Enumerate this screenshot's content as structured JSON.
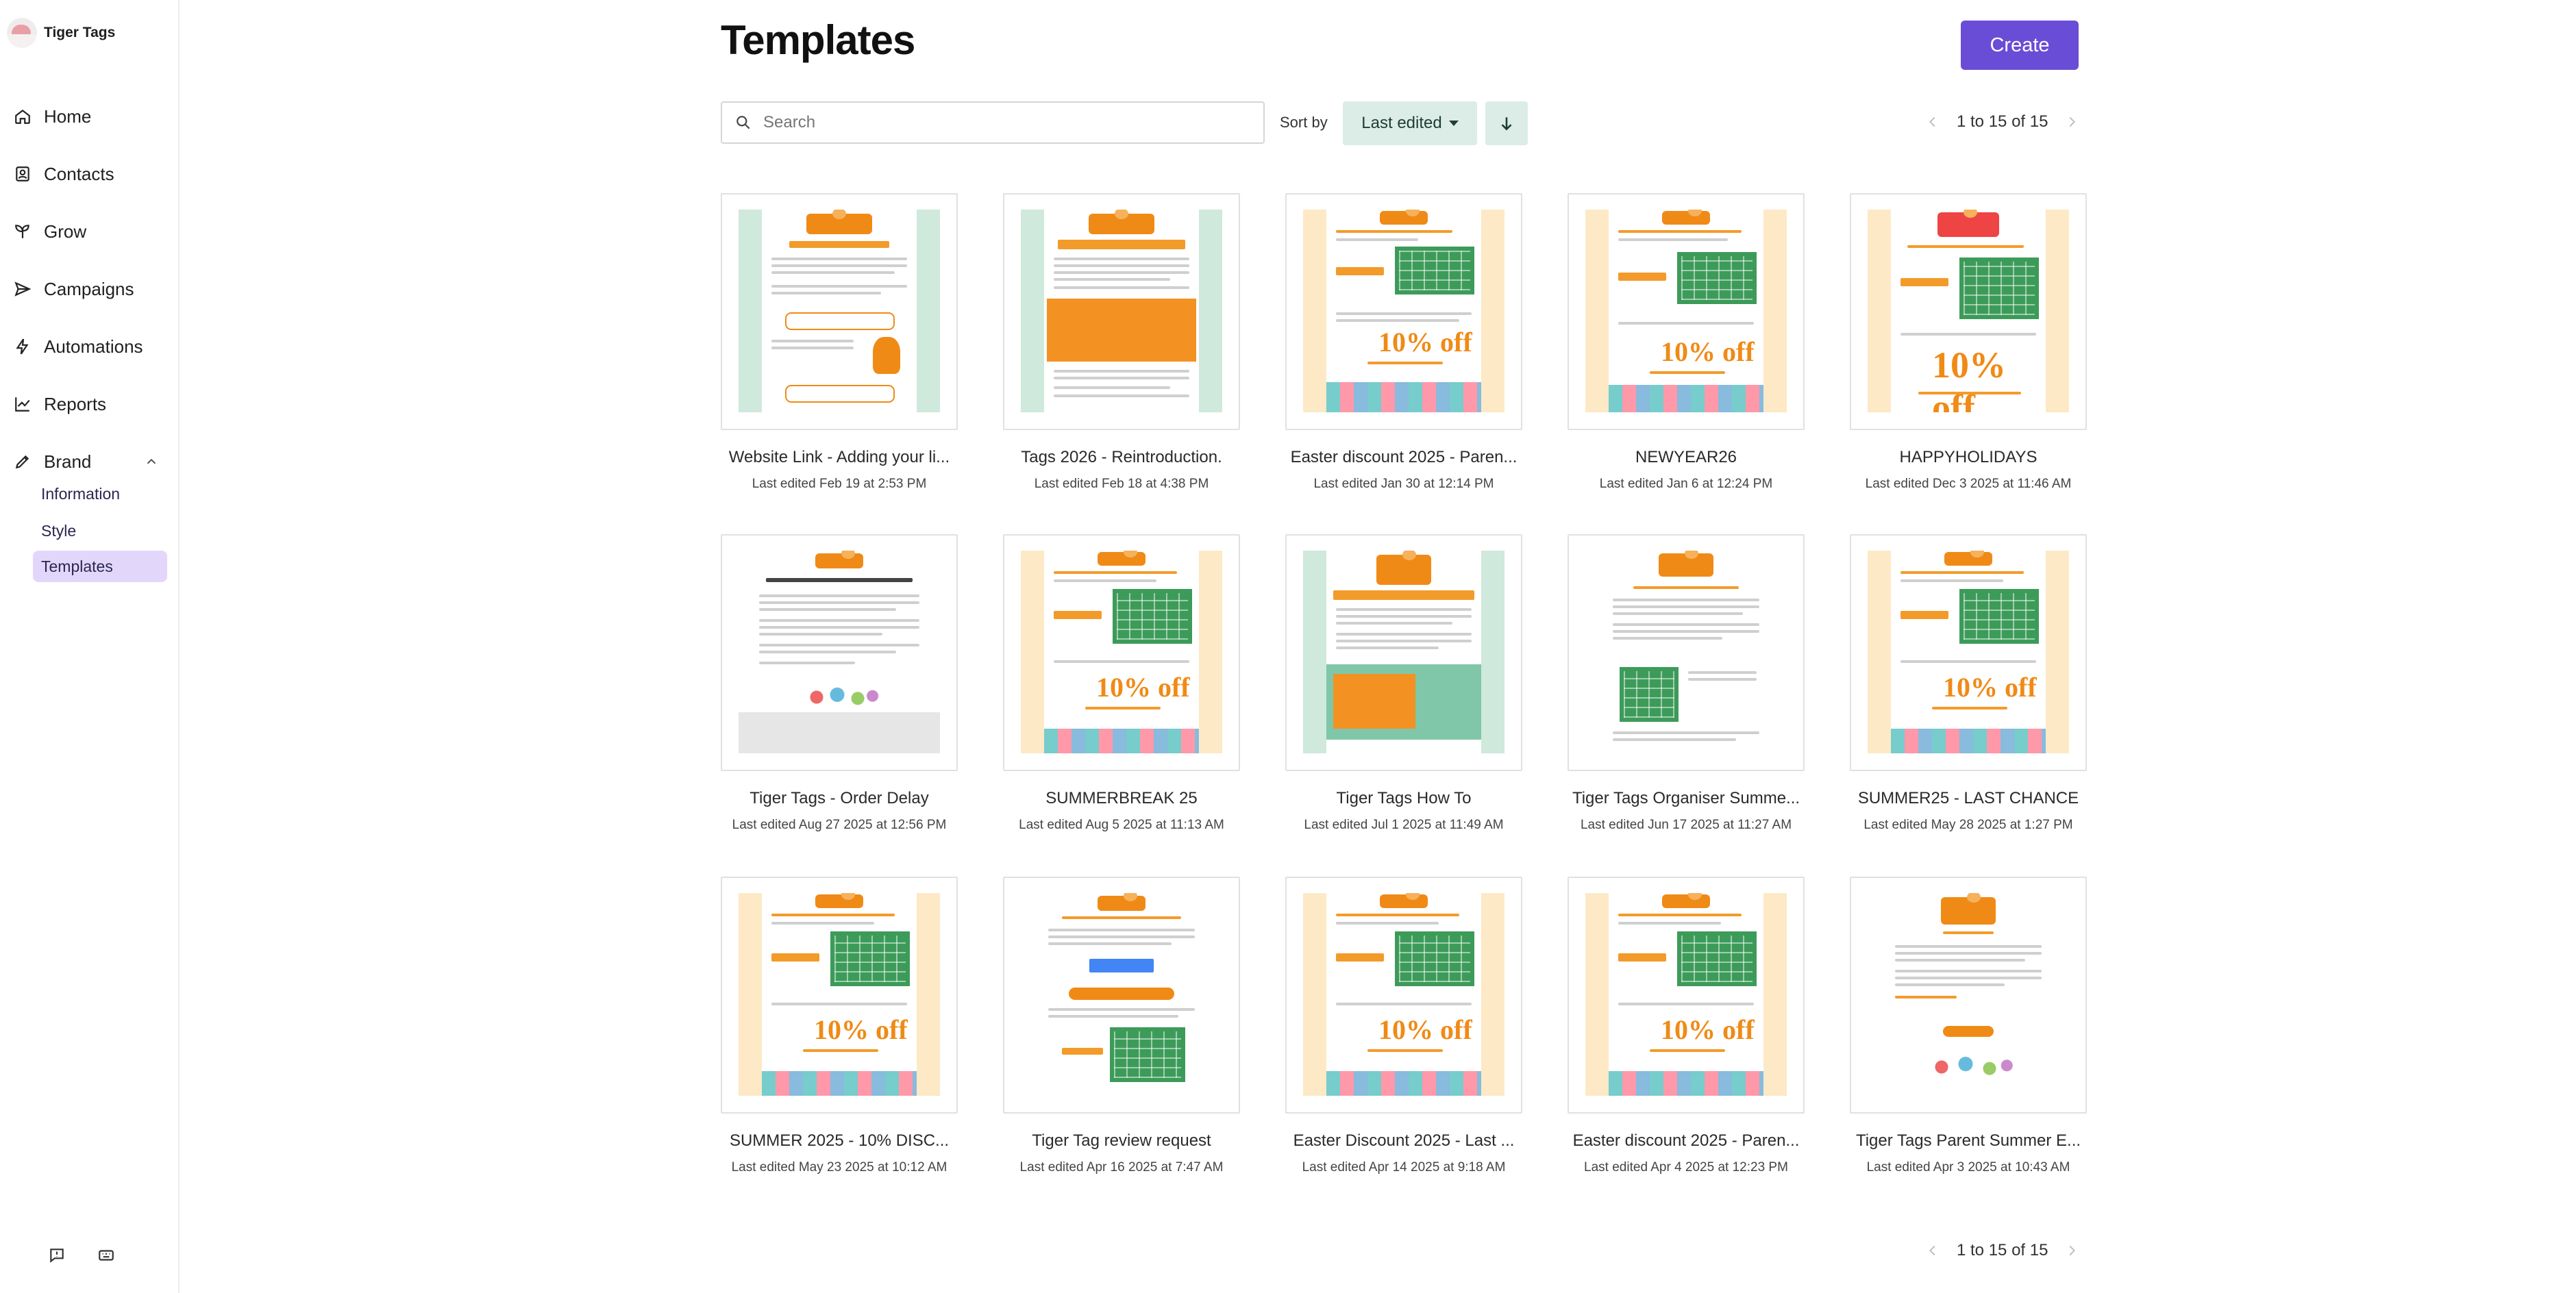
{
  "app": {
    "name": "Tiger Tags"
  },
  "sidebar": {
    "items": [
      {
        "label": "Home",
        "icon": "home-icon"
      },
      {
        "label": "Contacts",
        "icon": "contacts-icon"
      },
      {
        "label": "Grow",
        "icon": "grow-icon"
      },
      {
        "label": "Campaigns",
        "icon": "campaigns-icon"
      },
      {
        "label": "Automations",
        "icon": "automations-icon"
      },
      {
        "label": "Reports",
        "icon": "reports-icon"
      },
      {
        "label": "Brand",
        "icon": "brand-icon",
        "expanded": true
      }
    ],
    "brand_sub": [
      {
        "label": "Information"
      },
      {
        "label": "Style"
      },
      {
        "label": "Templates",
        "active": true
      }
    ],
    "bottom_icons": [
      "feedback-icon",
      "keyboard-shortcuts-icon"
    ]
  },
  "page": {
    "title": "Templates",
    "create_label": "Create"
  },
  "toolbar": {
    "search_placeholder": "Search",
    "sort_label": "Sort by",
    "sort_value": "Last edited",
    "sort_direction": "descending"
  },
  "pagination": {
    "text": "1 to 15 of 15"
  },
  "templates": [
    {
      "name": "Website Link - Adding your li...",
      "date": "Last edited Feb 19 at 2:53 PM"
    },
    {
      "name": "Tags 2026 - Reintroduction.",
      "date": "Last edited Feb 18 at 4:38 PM"
    },
    {
      "name": "Easter discount 2025 - Paren...",
      "date": "Last edited Jan 30 at 12:14 PM"
    },
    {
      "name": "NEWYEAR26",
      "date": "Last edited Jan 6 at 12:24 PM"
    },
    {
      "name": "HAPPYHOLIDAYS",
      "date": "Last edited Dec 3 2025 at 11:46 AM"
    },
    {
      "name": "Tiger Tags - Order Delay",
      "date": "Last edited Aug 27 2025 at 12:56 PM"
    },
    {
      "name": "SUMMERBREAK 25",
      "date": "Last edited Aug 5 2025 at 11:13 AM"
    },
    {
      "name": "Tiger Tags How To",
      "date": "Last edited Jul 1 2025 at 11:49 AM"
    },
    {
      "name": "Tiger Tags Organiser Summe...",
      "date": "Last edited Jun 17 2025 at 11:27 AM"
    },
    {
      "name": "SUMMER25 - LAST CHANCE",
      "date": "Last edited May 28 2025 at 1:27 PM"
    },
    {
      "name": "SUMMER 2025 - 10% DISC...",
      "date": "Last edited May 23 2025 at 10:12 AM"
    },
    {
      "name": "Tiger Tag review request",
      "date": "Last edited Apr 16 2025 at 7:47 AM"
    },
    {
      "name": "Easter Discount 2025 - Last ...",
      "date": "Last edited Apr 14 2025 at 9:18 AM"
    },
    {
      "name": "Easter discount 2025 - Paren...",
      "date": "Last edited Apr 4 2025 at 12:23 PM"
    },
    {
      "name": "Tiger Tags Parent Summer E...",
      "date": "Last edited Apr 3 2025 at 10:43 AM"
    }
  ],
  "colors": {
    "accent": "#6a4dd6",
    "sort_bg": "#dbede6",
    "active_nav": "#e2d7fb"
  }
}
